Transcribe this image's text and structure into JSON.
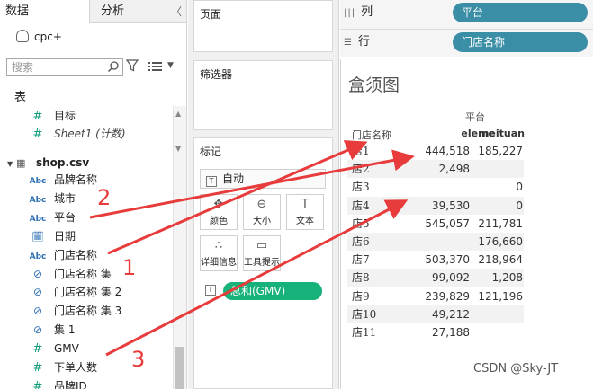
{
  "data_pane": {
    "tab_data": "数据",
    "tab_analysis": "分析",
    "datasource": "cpc+",
    "search_placeholder": "搜索",
    "tables_header": "表",
    "fields_top": [
      {
        "label": "目标",
        "type": "num",
        "italic": false
      },
      {
        "label": "Sheet1 (计数)",
        "type": "num",
        "italic": true
      }
    ],
    "table_name": "shop.csv",
    "fields": [
      {
        "label": "品牌名称",
        "type": "str"
      },
      {
        "label": "城市",
        "type": "str"
      },
      {
        "label": "平台",
        "type": "str"
      },
      {
        "label": "日期",
        "type": "date"
      },
      {
        "label": "门店名称",
        "type": "str"
      },
      {
        "label": "门店名称 集",
        "type": "set"
      },
      {
        "label": "门店名称 集 2",
        "type": "set"
      },
      {
        "label": "门店名称 集 3",
        "type": "set"
      },
      {
        "label": "集 1",
        "type": "set"
      },
      {
        "label": "GMV",
        "type": "num"
      },
      {
        "label": "下单人数",
        "type": "num"
      },
      {
        "label": "品牌ID",
        "type": "num"
      }
    ],
    "type_glyphs": {
      "str": "Abc",
      "num": "#",
      "date": "🗓",
      "set": "⊘"
    }
  },
  "cards": {
    "pages_title": "页面",
    "filters_title": "筛选器",
    "marks_title": "标记",
    "mark_type": "自动",
    "buttons": [
      {
        "label": "颜色",
        "icon": "✥"
      },
      {
        "label": "大小",
        "icon": "⊖"
      },
      {
        "label": "文本",
        "icon": "T"
      },
      {
        "label": "详细信息",
        "icon": "∴"
      },
      {
        "label": "工具提示",
        "icon": "▭"
      }
    ],
    "measure_pill": "总和(GMV)"
  },
  "shelves": {
    "columns_label": "列",
    "columns_pill": "平台",
    "rows_label": "行",
    "rows_pill": "门店名称"
  },
  "view": {
    "title": "盒须图",
    "column_group": "平台",
    "row_header": "门店名称",
    "col_headers": [
      "eleme",
      "meituan"
    ],
    "rows": [
      {
        "name": "店1",
        "eleme": "444,518",
        "meituan": "185,227"
      },
      {
        "name": "店2",
        "eleme": "2,498",
        "meituan": ""
      },
      {
        "name": "店3",
        "eleme": "",
        "meituan": "0"
      },
      {
        "name": "店4",
        "eleme": "39,530",
        "meituan": "0"
      },
      {
        "name": "店5",
        "eleme": "545,057",
        "meituan": "211,781"
      },
      {
        "name": "店6",
        "eleme": "",
        "meituan": "176,660"
      },
      {
        "name": "店7",
        "eleme": "503,370",
        "meituan": "218,964"
      },
      {
        "name": "店8",
        "eleme": "99,092",
        "meituan": "1,208"
      },
      {
        "name": "店9",
        "eleme": "239,829",
        "meituan": "121,196"
      },
      {
        "name": "店10",
        "eleme": "49,212",
        "meituan": ""
      },
      {
        "name": "店11",
        "eleme": "27,188",
        "meituan": ""
      }
    ]
  },
  "annotations": {
    "labels": [
      "1",
      "2",
      "3"
    ],
    "color": "#e83b3b"
  },
  "watermark": "CSDN @Sky-JT",
  "colors": {
    "pill_dimension": "#3a8ea6",
    "pill_measure": "#16b27a",
    "arrow": "#e83b3b"
  }
}
